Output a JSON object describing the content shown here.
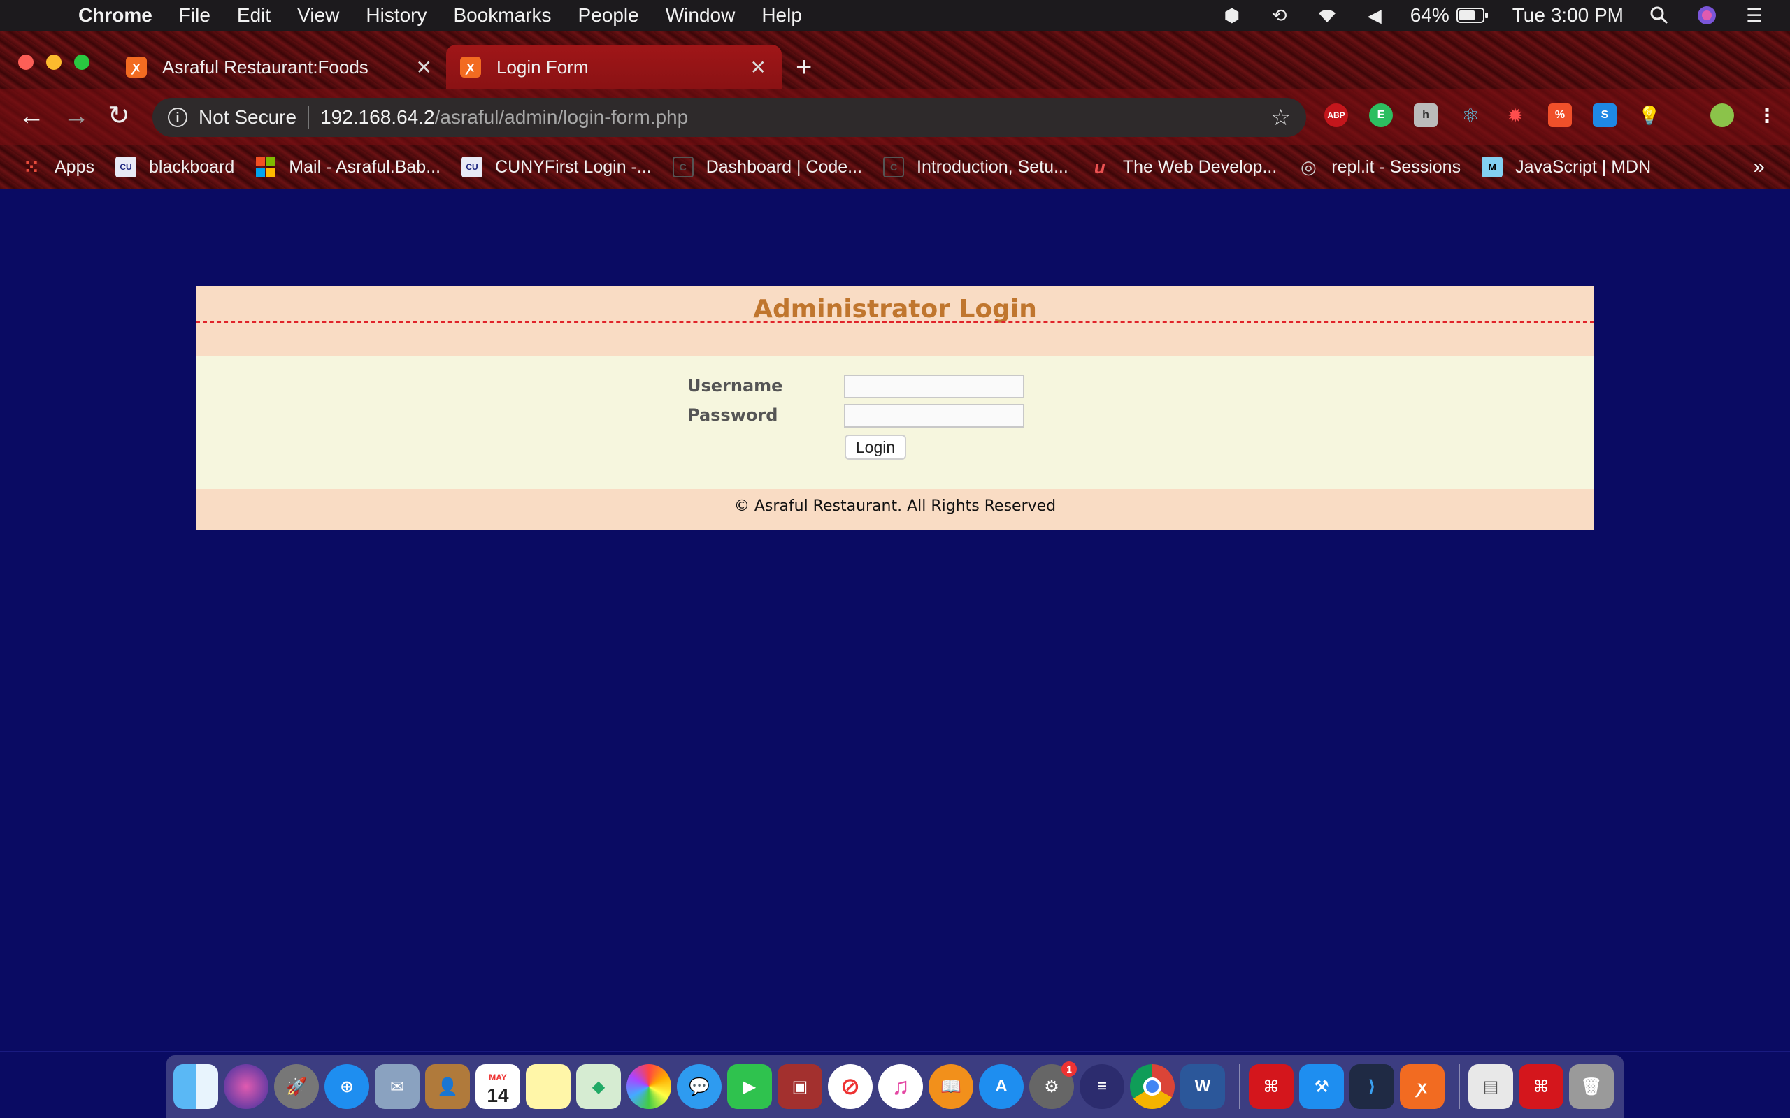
{
  "menubar": {
    "app_name": "Chrome",
    "items": [
      "File",
      "Edit",
      "View",
      "History",
      "Bookmarks",
      "People",
      "Window",
      "Help"
    ],
    "battery": "64%",
    "clock": "Tue 3:00 PM"
  },
  "tabs": [
    {
      "title": "Asraful Restaurant:Foods",
      "active": false
    },
    {
      "title": "Login Form",
      "active": true
    }
  ],
  "address_bar": {
    "security": "Not Secure",
    "host": "192.168.64.2",
    "path": "/asraful/admin/login-form.php"
  },
  "bookmarks": [
    {
      "label": "Apps",
      "icon": "apps-grid-icon"
    },
    {
      "label": "blackboard",
      "icon": "cuny-icon"
    },
    {
      "label": "Mail - Asraful.Bab...",
      "icon": "microsoft-icon"
    },
    {
      "label": "CUNYFirst Login -...",
      "icon": "cuny-icon"
    },
    {
      "label": "Dashboard | Code...",
      "icon": "codecademy-icon"
    },
    {
      "label": "Introduction, Setu...",
      "icon": "codecademy-icon"
    },
    {
      "label": "The Web Develop...",
      "icon": "udemy-icon"
    },
    {
      "label": "repl.it - Sessions",
      "icon": "replit-icon"
    },
    {
      "label": "JavaScript | MDN",
      "icon": "mdn-icon"
    }
  ],
  "login": {
    "title": "Administrator Login",
    "username_label": "Username",
    "password_label": "Password",
    "username_value": "",
    "password_value": "",
    "button_label": "Login",
    "footer": "© Asraful Restaurant. All Rights Reserved"
  },
  "dock": {
    "calendar_month": "MAY",
    "calendar_day": "14",
    "badge": "1"
  }
}
